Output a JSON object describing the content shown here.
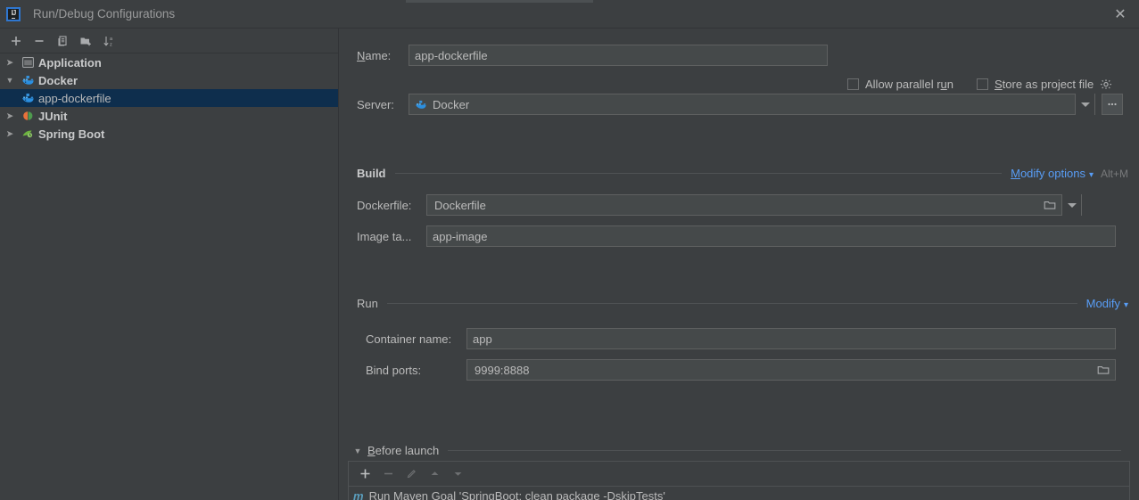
{
  "window": {
    "title": "Run/Debug Configurations",
    "logo_text": "IJ",
    "close_label": "✕"
  },
  "sidebar": {
    "toolbar": [
      {
        "name": "add-configuration-button",
        "icon": "plus-icon",
        "label": "+"
      },
      {
        "name": "remove-configuration-button",
        "icon": "minus-icon",
        "label": "−"
      },
      {
        "name": "copy-configuration-button",
        "icon": "copy-icon",
        "label": "copy"
      },
      {
        "name": "save-configuration-button",
        "icon": "folder-add-icon",
        "label": "folder"
      },
      {
        "name": "sort-configurations-button",
        "icon": "sort-alpha-icon",
        "label": "sort"
      }
    ],
    "items": [
      {
        "label": "Application",
        "icon": "application-icon",
        "expanded": false,
        "level": 0,
        "selected": false
      },
      {
        "label": "Docker",
        "icon": "docker-icon",
        "expanded": true,
        "level": 0,
        "selected": false
      },
      {
        "label": "app-dockerfile",
        "icon": "docker-icon",
        "expanded": null,
        "level": 1,
        "selected": true
      },
      {
        "label": "JUnit",
        "icon": "junit-icon",
        "expanded": false,
        "level": 0,
        "selected": false
      },
      {
        "label": "Spring Boot",
        "icon": "spring-boot-icon",
        "expanded": false,
        "level": 0,
        "selected": false
      }
    ]
  },
  "form": {
    "name": {
      "label_prefix": "N",
      "label_rest": "ame:",
      "value": "app-dockerfile",
      "placeholder": ""
    },
    "allow_parallel_run": {
      "label_a": "Allow parallel r",
      "label_u": "u",
      "label_b": "n",
      "checked": false
    },
    "store_as_project_file": {
      "label_s": "S",
      "label_rest": "tore as project file",
      "checked": false
    },
    "server": {
      "label": "Server:",
      "value": "Docker",
      "browse_label": "..."
    },
    "build_section": {
      "title": "Build",
      "modify_link_first": "M",
      "modify_link_rest": "odify options",
      "shortcut": "Alt+M"
    },
    "dockerfile": {
      "label": "Dockerfile:",
      "value": "Dockerfile"
    },
    "image_tag": {
      "label": "Image ta...",
      "value": "app-image"
    },
    "run_section": {
      "title": "Run",
      "modify_link": "Modify"
    },
    "container_name": {
      "label": "Container name:",
      "value": "app"
    },
    "bind_ports": {
      "label": "Bind ports:",
      "value": "9999:8888"
    },
    "before_launch": {
      "title_first": "B",
      "title_rest": "efore launch",
      "expanded": true,
      "toolbar": [
        {
          "name": "before-launch-add-button",
          "icon": "plus-icon"
        },
        {
          "name": "before-launch-remove-button",
          "icon": "minus-icon"
        },
        {
          "name": "before-launch-edit-button",
          "icon": "pencil-icon"
        },
        {
          "name": "before-launch-move-up-button",
          "icon": "arrow-up-icon"
        },
        {
          "name": "before-launch-move-down-button",
          "icon": "arrow-down-icon"
        }
      ],
      "items": [
        {
          "icon": "maven-icon",
          "icon_text": "m",
          "label": "Run Maven Goal 'SpringBoot: clean package  -DskipTests'"
        }
      ]
    }
  },
  "colors": {
    "panel_bg": "#3c3f41",
    "field_bg": "#45494a",
    "selection_bg": "#0e2e4d",
    "link": "#589df6",
    "text": "#bbbbbb",
    "docker_blue": "#2496ed",
    "maven_blue": "#5a9ebd"
  }
}
